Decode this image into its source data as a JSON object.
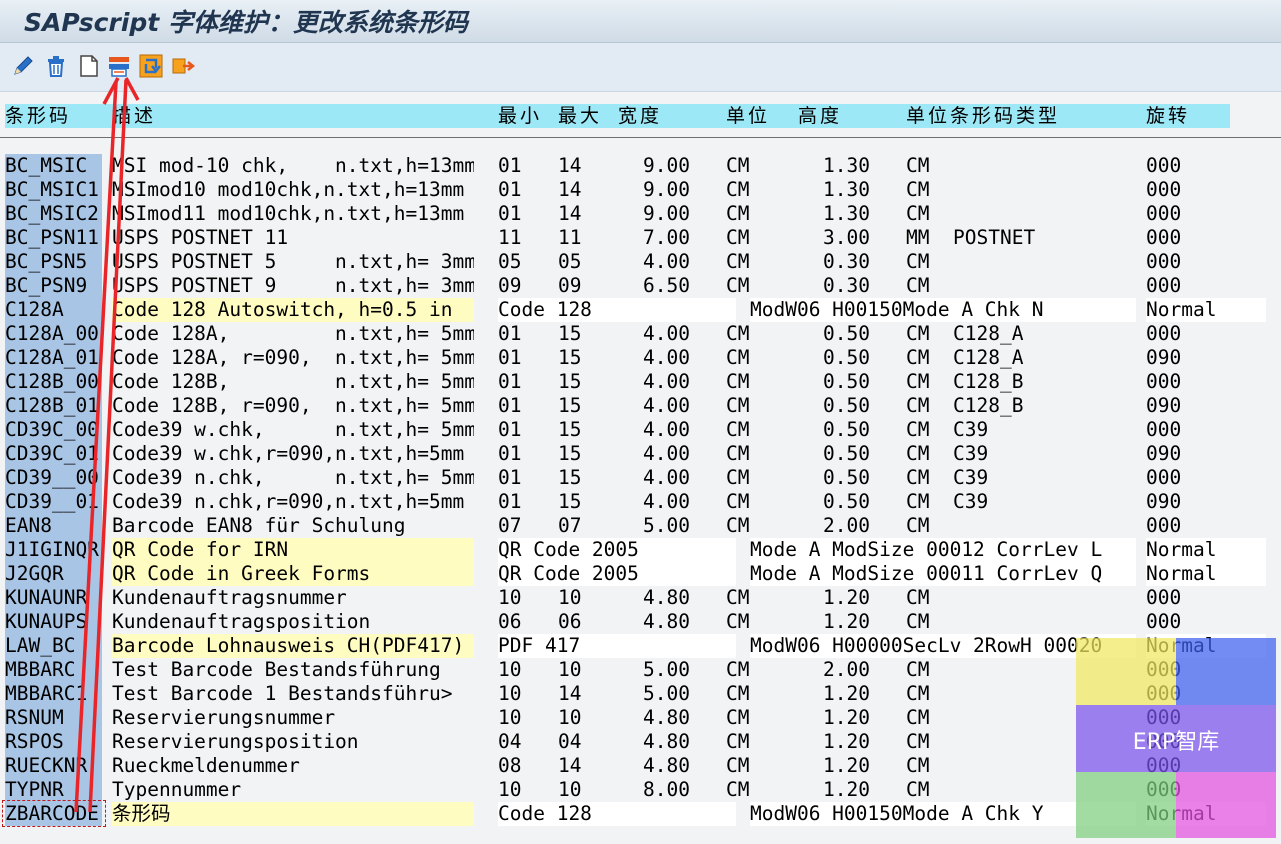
{
  "window": {
    "title": "SAPscript 字体维护：更改系统条形码"
  },
  "toolbar": {
    "buttons": [
      {
        "name": "pencil-icon",
        "label": "Change"
      },
      {
        "name": "trash-icon",
        "label": "Delete"
      },
      {
        "name": "new-document-icon",
        "label": "Create"
      },
      {
        "name": "test-print-icon",
        "label": "Test print"
      },
      {
        "name": "refresh-icon",
        "label": "Reload"
      },
      {
        "name": "transport-icon",
        "label": "Transport"
      }
    ]
  },
  "table": {
    "headers": {
      "barcode": "条形码",
      "desc": "描述",
      "min": "最小",
      "max": "最大",
      "width": "宽度",
      "unit": "单位",
      "height": "高度",
      "unit_type": "单位条形码类型",
      "rotation": "旋转"
    },
    "rows": [
      {
        "style": "std",
        "name": "BC_MSIC",
        "cells": [
          "MSI mod-10 chk,    n.txt,h=13mm",
          "01",
          "14",
          "9.00",
          "CM",
          "1.30",
          "CM",
          "",
          "000"
        ]
      },
      {
        "style": "std",
        "name": "BC_MSIC1",
        "cells": [
          "MSImod10 mod10chk,n.txt,h=13mm",
          "01",
          "14",
          "9.00",
          "CM",
          "1.30",
          "CM",
          "",
          "000"
        ]
      },
      {
        "style": "std",
        "name": "BC_MSIC2",
        "cells": [
          "MSImod11 mod10chk,n.txt,h=13mm",
          "01",
          "14",
          "9.00",
          "CM",
          "1.30",
          "CM",
          "",
          "000"
        ]
      },
      {
        "style": "std",
        "name": "BC_PSN11",
        "cells": [
          "USPS POSTNET 11",
          "11",
          "11",
          "7.00",
          "CM",
          "3.00",
          "MM",
          "POSTNET",
          "000"
        ]
      },
      {
        "style": "std",
        "name": "BC_PSN5",
        "cells": [
          "USPS POSTNET 5     n.txt,h= 3mm",
          "05",
          "05",
          "4.00",
          "CM",
          "0.30",
          "CM",
          "",
          "000"
        ]
      },
      {
        "style": "std",
        "name": "BC_PSN9",
        "cells": [
          "USPS POSTNET 9     n.txt,h= 3mm",
          "09",
          "09",
          "6.50",
          "CM",
          "0.30",
          "CM",
          "",
          "000"
        ]
      },
      {
        "style": "ext",
        "name": "C128A",
        "cells": [
          "Code 128 Autoswitch, h=0.5 in",
          "Code 128",
          "ModW06 H00150Mode A Chk N",
          "Normal"
        ]
      },
      {
        "style": "std",
        "name": "C128A_00",
        "cells": [
          "Code 128A,         n.txt,h= 5mm",
          "01",
          "15",
          "4.00",
          "CM",
          "0.50",
          "CM",
          "C128_A",
          "000"
        ]
      },
      {
        "style": "std",
        "name": "C128A_01",
        "cells": [
          "Code 128A, r=090,  n.txt,h= 5mm",
          "01",
          "15",
          "4.00",
          "CM",
          "0.50",
          "CM",
          "C128_A",
          "090"
        ]
      },
      {
        "style": "std",
        "name": "C128B_00",
        "cells": [
          "Code 128B,         n.txt,h= 5mm",
          "01",
          "15",
          "4.00",
          "CM",
          "0.50",
          "CM",
          "C128_B",
          "000"
        ]
      },
      {
        "style": "std",
        "name": "C128B_01",
        "cells": [
          "Code 128B, r=090,  n.txt,h= 5mm",
          "01",
          "15",
          "4.00",
          "CM",
          "0.50",
          "CM",
          "C128_B",
          "090"
        ]
      },
      {
        "style": "std",
        "name": "CD39C_00",
        "cells": [
          "Code39 w.chk,      n.txt,h= 5mm",
          "01",
          "15",
          "4.00",
          "CM",
          "0.50",
          "CM",
          "C39",
          "000"
        ]
      },
      {
        "style": "std",
        "name": "CD39C_01",
        "cells": [
          "Code39 w.chk,r=090,n.txt,h=5mm",
          "01",
          "15",
          "4.00",
          "CM",
          "0.50",
          "CM",
          "C39",
          "090"
        ]
      },
      {
        "style": "std",
        "name": "CD39__00",
        "cells": [
          "Code39 n.chk,      n.txt,h= 5mm",
          "01",
          "15",
          "4.00",
          "CM",
          "0.50",
          "CM",
          "C39",
          "000"
        ]
      },
      {
        "style": "std",
        "name": "CD39__01",
        "cells": [
          "Code39 n.chk,r=090,n.txt,h=5mm",
          "01",
          "15",
          "4.00",
          "CM",
          "0.50",
          "CM",
          "C39",
          "090"
        ]
      },
      {
        "style": "std",
        "name": "EAN8",
        "cells": [
          "Barcode EAN8 für Schulung",
          "07",
          "07",
          "5.00",
          "CM",
          "2.00",
          "CM",
          "",
          "000"
        ]
      },
      {
        "style": "ext",
        "name": "J1IGINQR",
        "cells": [
          "QR Code for IRN",
          "QR Code 2005",
          "Mode A ModSize 00012 CorrLev L",
          "Normal"
        ]
      },
      {
        "style": "ext",
        "name": "J2GQR",
        "cells": [
          "QR Code in Greek Forms",
          "QR Code 2005",
          "Mode A ModSize 00011 CorrLev Q",
          "Normal"
        ]
      },
      {
        "style": "std",
        "name": "KUNAUNR",
        "cells": [
          "Kundenauftragsnummer",
          "10",
          "10",
          "4.80",
          "CM",
          "1.20",
          "CM",
          "",
          "000"
        ]
      },
      {
        "style": "std",
        "name": "KUNAUPS",
        "cells": [
          "Kundenauftragsposition",
          "06",
          "06",
          "4.80",
          "CM",
          "1.20",
          "CM",
          "",
          "000"
        ]
      },
      {
        "style": "ext",
        "name": "LAW_BC",
        "cells": [
          "Barcode Lohnausweis CH(PDF417)",
          "PDF 417",
          "ModW06 H00000SecLv 2RowH 00020",
          "Normal"
        ]
      },
      {
        "style": "std",
        "name": "MBBARC",
        "cells": [
          "Test Barcode Bestandsführung",
          "10",
          "10",
          "5.00",
          "CM",
          "2.00",
          "CM",
          "",
          "000"
        ]
      },
      {
        "style": "std",
        "name": "MBBARC1",
        "cells": [
          "Test Barcode 1 Bestandsführu>",
          "10",
          "14",
          "5.00",
          "CM",
          "1.20",
          "CM",
          "",
          "000"
        ]
      },
      {
        "style": "std",
        "name": "RSNUM",
        "cells": [
          "Reservierungsnummer",
          "10",
          "10",
          "4.80",
          "CM",
          "1.20",
          "CM",
          "",
          "000"
        ]
      },
      {
        "style": "std",
        "name": "RSPOS",
        "cells": [
          "Reservierungsposition",
          "04",
          "04",
          "4.80",
          "CM",
          "1.20",
          "CM",
          "",
          "000"
        ]
      },
      {
        "style": "std",
        "name": "RUECKNR",
        "cells": [
          "Rueckmeldenummer",
          "08",
          "14",
          "4.80",
          "CM",
          "1.20",
          "CM",
          "",
          "000"
        ]
      },
      {
        "style": "std",
        "name": "TYPNR",
        "cells": [
          "Typennummer",
          "10",
          "10",
          "8.00",
          "CM",
          "1.20",
          "CM",
          "",
          "000"
        ]
      },
      {
        "style": "ext",
        "name": "ZBARCODE",
        "cells": [
          "条形码",
          "Code 128",
          "ModW06 H00150Mode A Chk Y",
          "Normal"
        ]
      }
    ]
  },
  "watermark": {
    "text": "ERP智库",
    "colors": [
      "#f0e860",
      "#3c5ff0",
      "#7a52ec",
      "#7fcf80",
      "#e050e0"
    ]
  },
  "annotation_color": "#e8262a"
}
